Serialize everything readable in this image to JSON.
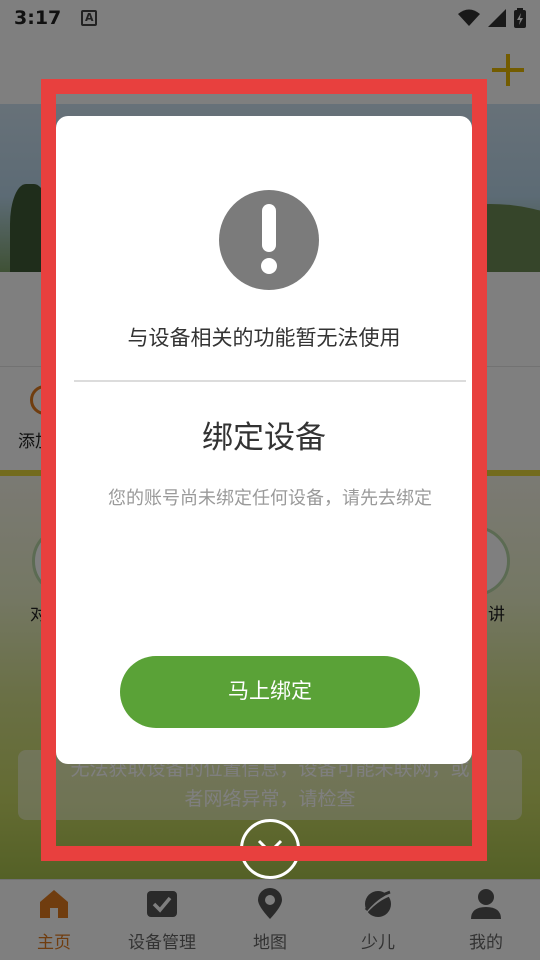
{
  "status_bar": {
    "time": "3:17",
    "badge": "A",
    "icons": [
      "wifi-icon",
      "signal-icon",
      "battery-charging-icon"
    ]
  },
  "header": {
    "action_icon": "plus-icon"
  },
  "quick_actions": {
    "left_label": "添加"
  },
  "feature_row": {
    "left_label": "对",
    "right_label": "讲"
  },
  "notice": {
    "line1": "无法获取设备的位置信息，设备可能未联网，或",
    "line2": "者网络异常，请检查"
  },
  "bottom_nav": {
    "items": [
      {
        "label": "主页",
        "icon": "home-icon",
        "active": true
      },
      {
        "label": "设备管理",
        "icon": "device-manage-icon",
        "active": false
      },
      {
        "label": "地图",
        "icon": "map-pin-icon",
        "active": false
      },
      {
        "label": "少儿",
        "icon": "children-icon",
        "active": false
      },
      {
        "label": "我的",
        "icon": "profile-icon",
        "active": false
      }
    ]
  },
  "dialog": {
    "icon": "alert-icon",
    "subtitle": "与设备相关的功能暂无法使用",
    "title": "绑定设备",
    "message": "您的账号尚未绑定任何设备，请先去绑定",
    "button_label": "马上绑定",
    "close_icon": "close-icon"
  },
  "colors": {
    "accent_green": "#5aa237",
    "active_orange": "#e07a1e",
    "highlight_red": "#e8403e"
  }
}
